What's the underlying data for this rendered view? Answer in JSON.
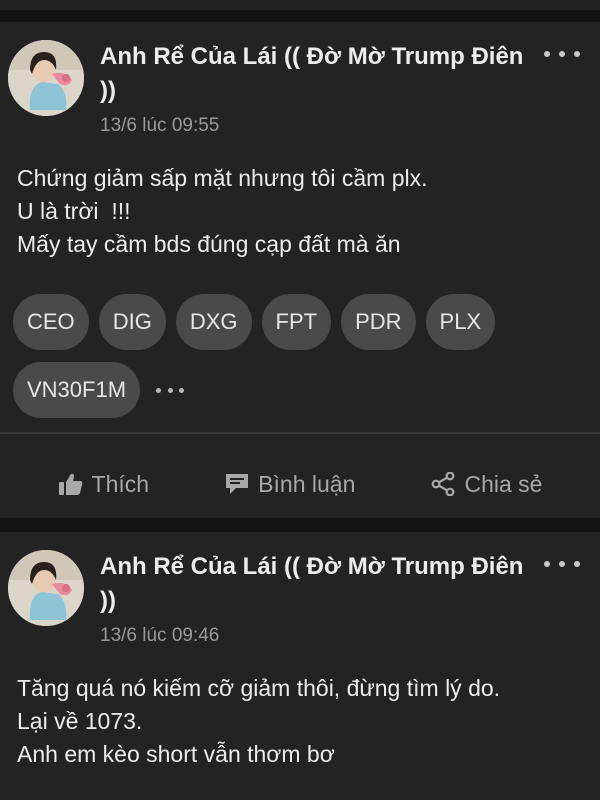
{
  "posts": [
    {
      "author": "Anh Rể Của Lái (( Đờ Mờ Trump Điên ))",
      "timestamp": "13/6 lúc 09:55",
      "content_lines": [
        "Chứng giảm sấp mặt nhưng tôi cầm plx.",
        "U là trời  !!!",
        "Mấy tay cầm bds đúng cạp đất mà ăn"
      ],
      "tags": [
        "CEO",
        "DIG",
        "DXG",
        "FPT",
        "PDR",
        "PLX",
        "VN30F1M"
      ],
      "actions": {
        "like": "Thích",
        "comment": "Bình luận",
        "share": "Chia sẻ"
      }
    },
    {
      "author": "Anh Rể Của Lái (( Đờ Mờ Trump Điên ))",
      "timestamp": "13/6 lúc 09:46",
      "content_lines": [
        "Tăng quá nó kiếm cỡ giảm thôi, đừng tìm lý do.",
        "Lại về 1073.",
        "Anh em kèo short vẫn thơm bơ"
      ]
    }
  ],
  "icons": {
    "more": "more-dots-icon",
    "like": "thumbs-up-icon",
    "comment": "comment-icon",
    "share": "share-icon"
  },
  "colors": {
    "background": "#131313",
    "card": "#232323",
    "tag_bg": "#4a4a4a",
    "muted_text": "#9a9a9a"
  }
}
